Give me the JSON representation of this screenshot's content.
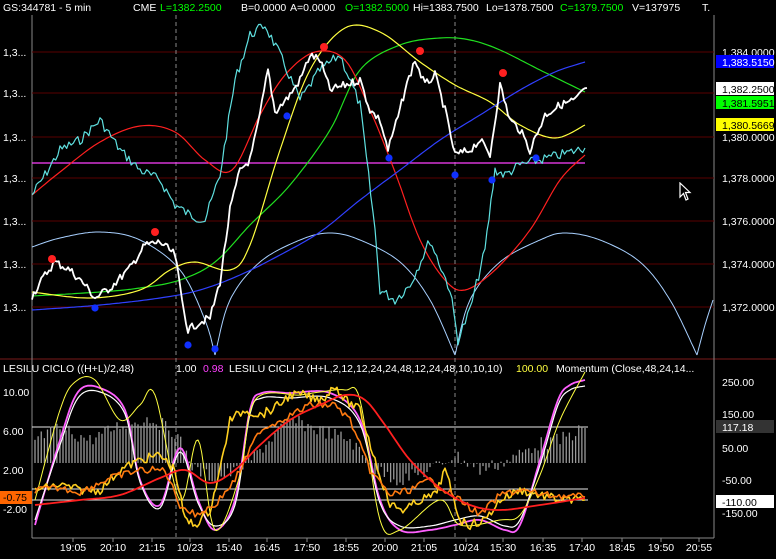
{
  "header": {
    "symbol": "GS:344781 - 5 min",
    "exchange": "CME",
    "last": "L=1382.2500",
    "bid": "B=0.0000",
    "ask": "A=0.0000",
    "open": "O=1382.5000",
    "high": "Hi=1383.7500",
    "low": "Lo=1378.7500",
    "close": "C=1379.7500",
    "volume": "V=137975",
    "trail": "T."
  },
  "subpanel": {
    "ind1": "LESILU CICLO  ((H+L)/2,48)",
    "ind1_v1": "1.00",
    "ind1_v2": "0.98",
    "ind2": "LESILU CICLI 2  (H+L,2,12,12,24,24,48,12,24,48,10,10,10)",
    "ind2_v": "100.00",
    "ind3": "Momentum  (Close,48,24,14..."
  },
  "price_axis": {
    "left_ticks": [
      "1,3...",
      "1,3...",
      "1,3...",
      "1,3...",
      "1,3...",
      "1,3...",
      "1,3..."
    ],
    "right_ticks": [
      "1,384.0000",
      "1,380.0000",
      "1,378.0000",
      "1,376.0000",
      "1,374.0000",
      "1,372.0000"
    ],
    "labels": [
      {
        "text": "1,383.5150",
        "bg": "#0000ff",
        "fg": "#ffffff"
      },
      {
        "text": "1,382.2500",
        "bg": "#ffffff",
        "fg": "#000000"
      },
      {
        "text": "1,381.5951",
        "bg": "#00ff00",
        "fg": "#000000"
      },
      {
        "text": "1,380.5669",
        "bg": "#ffff00",
        "fg": "#000000"
      }
    ]
  },
  "osc_axis": {
    "left_ticks": [
      "10.00",
      "6.00",
      "2.00",
      "-2.00"
    ],
    "left_label": {
      "text": "-0.75",
      "bg": "#ff6600",
      "fg": "#000000"
    },
    "right_ticks": [
      "250.00",
      "150.00",
      "50.00",
      "-50.00",
      "-150.00"
    ],
    "labels": [
      {
        "text": "117.18",
        "bg": "#333333",
        "fg": "#ffffff"
      },
      {
        "text": "-110.00",
        "bg": "#ffffff",
        "fg": "#000000"
      }
    ]
  },
  "time_axis": [
    "19:05",
    "20:10",
    "21:15",
    "10/23",
    "15:40",
    "16:45",
    "17:50",
    "18:55",
    "20:00",
    "21:05",
    "10/24",
    "15:30",
    "16:35",
    "17:40",
    "18:45",
    "19:50",
    "20:55"
  ],
  "colors": {
    "price": "#ffffff",
    "cyan": "#5fe0e0",
    "red": "#ff2020",
    "yellow": "#ffff40",
    "green": "#20e020",
    "blue": "#3040ff",
    "magenta": "#ff40ff",
    "cycle": "#a8d0ff",
    "grid": "#5a0000",
    "axis": "#888888"
  }
}
